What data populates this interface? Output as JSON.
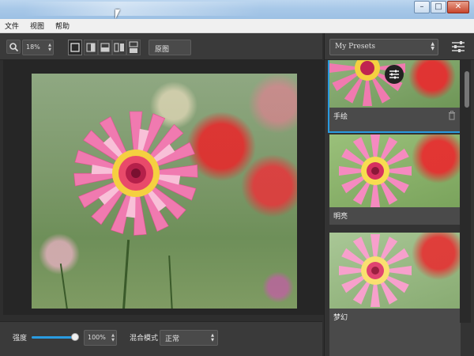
{
  "menu": {
    "file": "文件",
    "view": "视图",
    "help": "帮助"
  },
  "window_controls": {
    "minimize": "–",
    "maximize": "□",
    "close": "✕"
  },
  "toolbar": {
    "zoom_value": "18%",
    "view_modes": [
      "single-view",
      "split-vertical",
      "split-horizontal",
      "side-by-side",
      "stacked"
    ],
    "active_view_mode": "single-view",
    "before_button": "原图"
  },
  "presets": {
    "dropdown_value": "My Presets",
    "items": [
      {
        "label": "手绘",
        "selected": true
      },
      {
        "label": "明亮",
        "selected": false
      },
      {
        "label": "梦幻",
        "selected": false
      }
    ]
  },
  "bottom": {
    "strength_label": "强度",
    "strength_value": "100%",
    "strength_level": 1.0,
    "blend_label": "混合模式",
    "blend_value": "正常"
  },
  "colors": {
    "accent": "#2a9be0",
    "panel": "#3a3a3a",
    "canvas": "#262626"
  },
  "icons": {
    "zoom": "magnifier-icon",
    "adjust": "sliders-icon",
    "delete": "trash-icon"
  }
}
